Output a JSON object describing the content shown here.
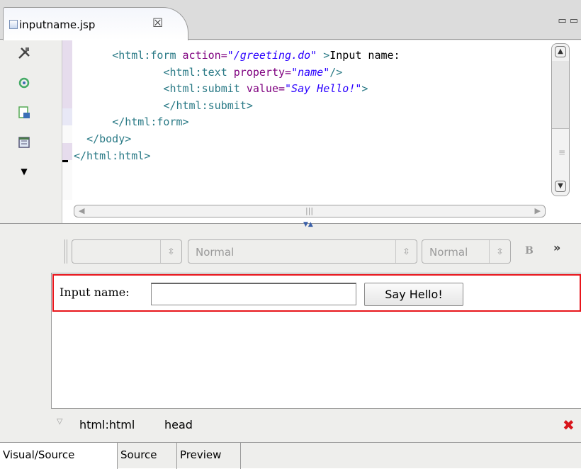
{
  "editor_tab": {
    "title": "inputname.jsp",
    "close": "☒"
  },
  "window_controls": "▭▭",
  "code_lines": [
    [
      {
        "t": "      ",
        "c": "plain"
      },
      {
        "t": "<html:form",
        "c": "tag"
      },
      {
        "t": " action=",
        "c": "attr"
      },
      {
        "t": "\"/greeting.do\"",
        "c": "str"
      },
      {
        "t": " >",
        "c": "tag"
      },
      {
        "t": "Input name:",
        "c": "plain"
      }
    ],
    [
      {
        "t": "              ",
        "c": "plain"
      },
      {
        "t": "<html:text",
        "c": "tag"
      },
      {
        "t": " property=",
        "c": "attr"
      },
      {
        "t": "\"name\"",
        "c": "str"
      },
      {
        "t": "/>",
        "c": "tag"
      }
    ],
    [
      {
        "t": "              ",
        "c": "plain"
      },
      {
        "t": "<html:submit",
        "c": "tag"
      },
      {
        "t": " value=",
        "c": "attr"
      },
      {
        "t": "\"Say Hello!\"",
        "c": "str"
      },
      {
        "t": ">",
        "c": "tag"
      }
    ],
    [
      {
        "t": "              ",
        "c": "plain"
      },
      {
        "t": "</html:submit>",
        "c": "tag"
      }
    ],
    [
      {
        "t": "      ",
        "c": "plain"
      },
      {
        "t": "</html:form>",
        "c": "tag"
      }
    ],
    [
      {
        "t": "  ",
        "c": "plain"
      },
      {
        "t": "</body>",
        "c": "tag"
      }
    ],
    [
      {
        "t": "</html:html>",
        "c": "tag"
      }
    ]
  ],
  "format_toolbar": {
    "paragraph_style": "",
    "font": "Normal",
    "size": "Normal",
    "bold": "B",
    "more": "»"
  },
  "visual_form": {
    "label": "Input name:",
    "input_value": "",
    "button_label": "Say Hello!"
  },
  "breadcrumb": {
    "items": [
      "html:html",
      "head"
    ]
  },
  "bottom_tabs": [
    "Visual/Source",
    "Source",
    "Preview"
  ],
  "colors": {
    "selection_border": "#e8151b",
    "tag": "#2a7a86",
    "attribute": "#7f007f",
    "string": "#2a00ff",
    "delete_icon": "#d8141a"
  }
}
